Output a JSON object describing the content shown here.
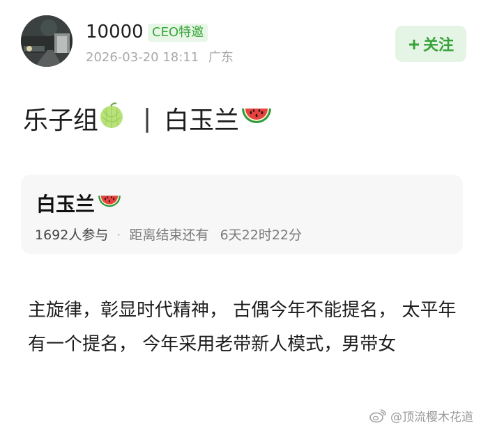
{
  "post": {
    "username": "10000",
    "badge": "CEO特邀",
    "timestamp": "2026-03-20 18:11",
    "location": "广东",
    "follow_label": "关注",
    "title_left": "乐子组",
    "title_separator": "|",
    "title_right": "白玉兰",
    "body": "主旋律，彰显时代精神， 古偶今年不能提名， 太平年有一个提名， 今年采用老带新人模式，男带女"
  },
  "poll": {
    "title": "白玉兰",
    "participants": "1692人参与",
    "dot": "·",
    "remaining_label": "距离结束还有",
    "remaining_value": "6天22时22分"
  },
  "watermark": {
    "text": "@顶流樱木花道"
  },
  "icons": {
    "avatar": "night-street-photo",
    "plus": "plus-icon",
    "melon": "melon-emoji",
    "watermelon": "watermelon-emoji",
    "weibo": "weibo-logo-icon"
  },
  "colors": {
    "badge_text": "#3aa63a",
    "badge_bg": "#e7f6e7",
    "follow_text": "#37a13a",
    "follow_bg": "#e5f5e5",
    "card_bg": "#f7f7f7",
    "meta_gray": "#a8a8a8"
  }
}
